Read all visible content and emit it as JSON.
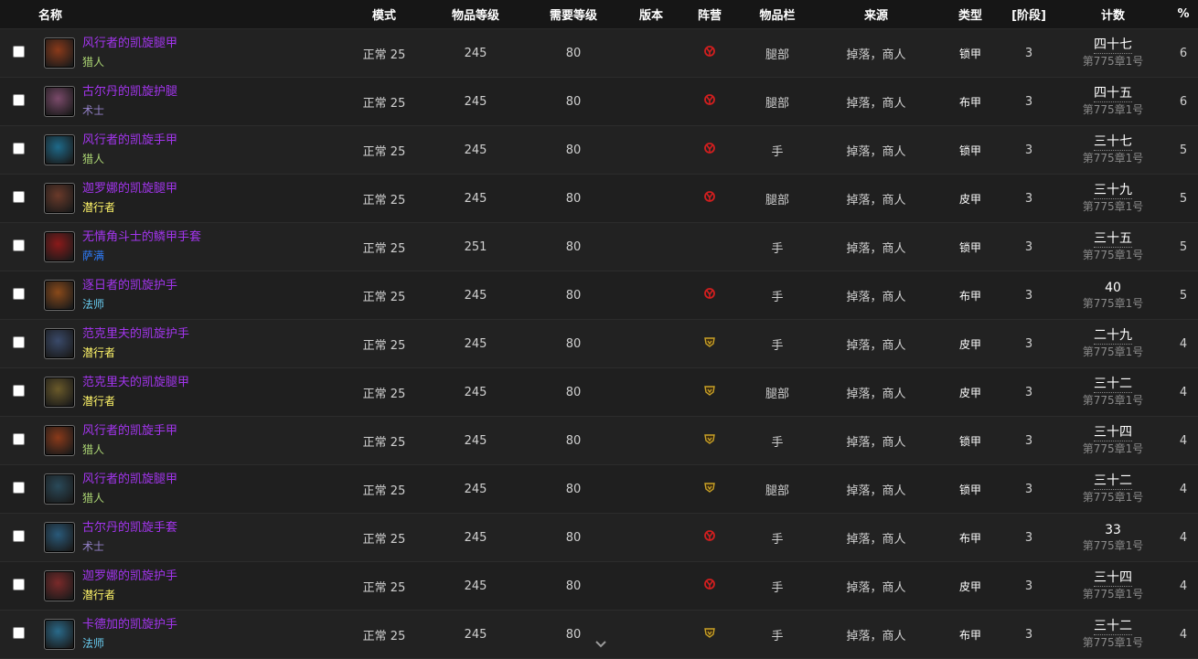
{
  "headers": {
    "name": "名称",
    "mode": "模式",
    "item_level": "物品等级",
    "req_level": "需要等级",
    "version": "版本",
    "faction": "阵营",
    "slot": "物品栏",
    "source": "来源",
    "type": "类型",
    "phase": "[阶段]",
    "count": "计数",
    "percent": "%"
  },
  "colors": {
    "epic": "#a335ee",
    "hunter": "#abd473",
    "warlock": "#9482c9",
    "rogue": "#fff569",
    "shaman": "#2e7dff",
    "mage": "#69ccf0",
    "horde": "#d21f1f",
    "alliance": "#c9a227"
  },
  "rows": [
    {
      "name": "风行者的凯旋腿甲",
      "class": "猎人",
      "class_color": "#abd473",
      "icon": "leg-armor-icon",
      "icon_color": "#8a3a1a",
      "mode": "正常 25",
      "ilvl": "245",
      "req": "80",
      "version": "",
      "faction": "horde",
      "slot": "腿部",
      "source": "掉落，商人",
      "type": "锁甲",
      "phase": "3",
      "count": "四十七",
      "date": "第775章1号",
      "pct": "6"
    },
    {
      "name": "古尔丹的凯旋护腿",
      "class": "术士",
      "class_color": "#9482c9",
      "icon": "leg-armor-icon",
      "icon_color": "#7a4a6a",
      "mode": "正常 25",
      "ilvl": "245",
      "req": "80",
      "version": "",
      "faction": "horde",
      "slot": "腿部",
      "source": "掉落，商人",
      "type": "布甲",
      "phase": "3",
      "count": "四十五",
      "date": "第775章1号",
      "pct": "6"
    },
    {
      "name": "风行者的凯旋手甲",
      "class": "猎人",
      "class_color": "#abd473",
      "icon": "gauntlet-icon",
      "icon_color": "#1e6a8a",
      "mode": "正常 25",
      "ilvl": "245",
      "req": "80",
      "version": "",
      "faction": "horde",
      "slot": "手",
      "source": "掉落，商人",
      "type": "锁甲",
      "phase": "3",
      "count": "三十七",
      "date": "第775章1号",
      "pct": "5"
    },
    {
      "name": "迦罗娜的凯旋腿甲",
      "class": "潜行者",
      "class_color": "#fff569",
      "icon": "leg-armor-icon",
      "icon_color": "#6a3a2a",
      "mode": "正常 25",
      "ilvl": "245",
      "req": "80",
      "version": "",
      "faction": "horde",
      "slot": "腿部",
      "source": "掉落，商人",
      "type": "皮甲",
      "phase": "3",
      "count": "三十九",
      "date": "第775章1号",
      "pct": "5"
    },
    {
      "name": "无情角斗士的鳞甲手套",
      "class": "萨满",
      "class_color": "#2e7dff",
      "icon": "gauntlet-icon",
      "icon_color": "#8a1a1a",
      "mode": "正常 25",
      "ilvl": "251",
      "req": "80",
      "version": "",
      "faction": "",
      "slot": "手",
      "source": "掉落，商人",
      "type": "锁甲",
      "phase": "3",
      "count": "三十五",
      "date": "第775章1号",
      "pct": "5"
    },
    {
      "name": "逐日者的凯旋护手",
      "class": "法师",
      "class_color": "#69ccf0",
      "icon": "gauntlet-icon",
      "icon_color": "#8a4a1a",
      "mode": "正常 25",
      "ilvl": "245",
      "req": "80",
      "version": "",
      "faction": "horde",
      "slot": "手",
      "source": "掉落，商人",
      "type": "布甲",
      "phase": "3",
      "count": "40",
      "date": "第775章1号",
      "pct": "5"
    },
    {
      "name": "范克里夫的凯旋护手",
      "class": "潜行者",
      "class_color": "#fff569",
      "icon": "gauntlet-icon",
      "icon_color": "#3a4a6a",
      "mode": "正常 25",
      "ilvl": "245",
      "req": "80",
      "version": "",
      "faction": "alliance",
      "slot": "手",
      "source": "掉落，商人",
      "type": "皮甲",
      "phase": "3",
      "count": "二十九",
      "date": "第775章1号",
      "pct": "4"
    },
    {
      "name": "范克里夫的凯旋腿甲",
      "class": "潜行者",
      "class_color": "#fff569",
      "icon": "leg-armor-icon",
      "icon_color": "#6a5a2a",
      "mode": "正常 25",
      "ilvl": "245",
      "req": "80",
      "version": "",
      "faction": "alliance",
      "slot": "腿部",
      "source": "掉落，商人",
      "type": "皮甲",
      "phase": "3",
      "count": "三十二",
      "date": "第775章1号",
      "pct": "4"
    },
    {
      "name": "风行者的凯旋手甲",
      "class": "猎人",
      "class_color": "#abd473",
      "icon": "gauntlet-icon",
      "icon_color": "#8a3a1a",
      "mode": "正常 25",
      "ilvl": "245",
      "req": "80",
      "version": "",
      "faction": "alliance",
      "slot": "手",
      "source": "掉落，商人",
      "type": "锁甲",
      "phase": "3",
      "count": "三十四",
      "date": "第775章1号",
      "pct": "4"
    },
    {
      "name": "风行者的凯旋腿甲",
      "class": "猎人",
      "class_color": "#abd473",
      "icon": "leg-armor-icon",
      "icon_color": "#2a4a5a",
      "mode": "正常 25",
      "ilvl": "245",
      "req": "80",
      "version": "",
      "faction": "alliance",
      "slot": "腿部",
      "source": "掉落，商人",
      "type": "锁甲",
      "phase": "3",
      "count": "三十二",
      "date": "第775章1号",
      "pct": "4"
    },
    {
      "name": "古尔丹的凯旋手套",
      "class": "术士",
      "class_color": "#9482c9",
      "icon": "gauntlet-icon",
      "icon_color": "#2a5a7a",
      "mode": "正常 25",
      "ilvl": "245",
      "req": "80",
      "version": "",
      "faction": "horde",
      "slot": "手",
      "source": "掉落，商人",
      "type": "布甲",
      "phase": "3",
      "count": "33",
      "date": "第775章1号",
      "pct": "4"
    },
    {
      "name": "迦罗娜的凯旋护手",
      "class": "潜行者",
      "class_color": "#fff569",
      "icon": "gauntlet-icon",
      "icon_color": "#7a2a2a",
      "mode": "正常 25",
      "ilvl": "245",
      "req": "80",
      "version": "",
      "faction": "horde",
      "slot": "手",
      "source": "掉落，商人",
      "type": "皮甲",
      "phase": "3",
      "count": "三十四",
      "date": "第775章1号",
      "pct": "4"
    },
    {
      "name": "卡德加的凯旋护手",
      "class": "法师",
      "class_color": "#69ccf0",
      "icon": "gauntlet-icon",
      "icon_color": "#2a6a8a",
      "mode": "正常 25",
      "ilvl": "245",
      "req": "80",
      "version": "",
      "faction": "alliance",
      "slot": "手",
      "source": "掉落，商人",
      "type": "布甲",
      "phase": "3",
      "count": "三十二",
      "date": "第775章1号",
      "pct": "4"
    }
  ]
}
